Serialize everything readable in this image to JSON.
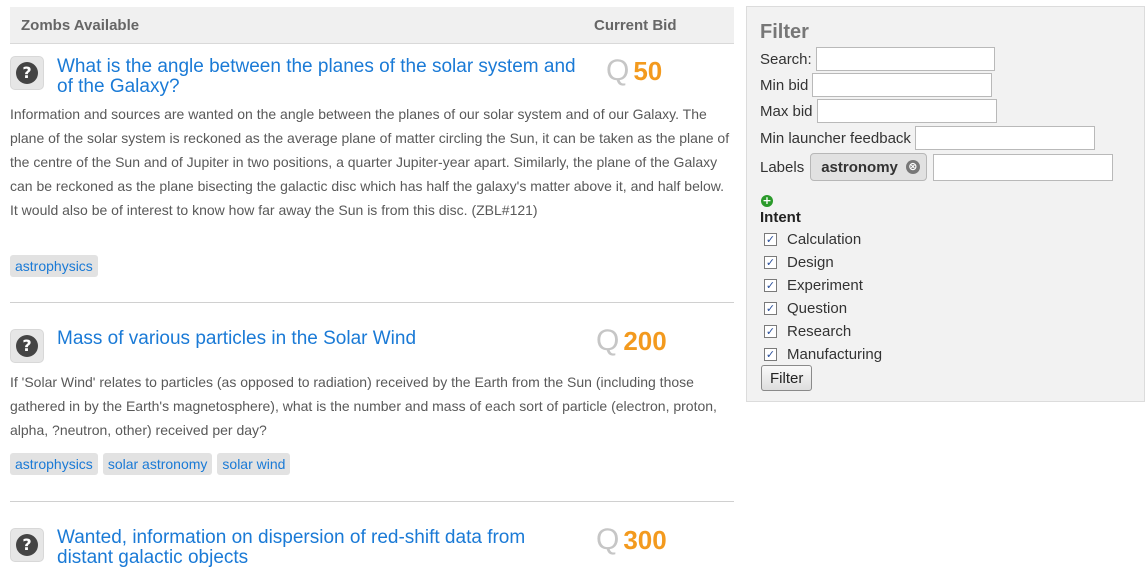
{
  "listing": {
    "col_title": "Zombs Available",
    "col_bid": "Current Bid",
    "bid_symbol": "Q",
    "zombs": [
      {
        "title": "What is the angle between the planes of the solar system and of the Galaxy?",
        "bid": "50",
        "description": "Information and sources are wanted on the angle between the planes of our solar system and of our Galaxy. The plane of the solar system is reckoned as the average plane of matter circling the Sun, it can be taken as the plane of the centre of the Sun and of Jupiter in two positions, a quarter Jupiter-year apart. Similarly, the plane of the Galaxy can be reckoned as the plane bisecting the galactic disc which has half the galaxy's matter above it, and half below. It would also be of interest to know how far away the Sun is from this disc. (ZBL#121)",
        "tags": [
          "astrophysics"
        ]
      },
      {
        "title": "Mass of various particles in the Solar Wind",
        "bid": "200",
        "description": "If 'Solar Wind' relates to particles (as opposed to radiation) received by the Earth from the Sun (including those gathered in by the Earth's magnetosphere), what is the number and mass of each sort of particle (electron, proton, alpha, ?neutron, other) received per day?",
        "tags": [
          "astrophysics",
          "solar astronomy",
          "solar wind"
        ]
      },
      {
        "title": "Wanted, information on dispersion of red-shift data from distant galactic objects",
        "bid": "300",
        "description": "",
        "tags": []
      }
    ]
  },
  "filter": {
    "title": "Filter",
    "search_label": "Search:",
    "search_value": "",
    "min_bid_label": "Min bid",
    "min_bid_value": "",
    "max_bid_label": "Max bid",
    "max_bid_value": "",
    "min_feedback_label": "Min launcher feedback",
    "min_feedback_value": "",
    "labels_label": "Labels",
    "label_chip": "astronomy",
    "chip_remove": "⊗",
    "labels_input_value": "",
    "add_icon_glyph": "+",
    "intent_title": "Intent",
    "check_glyph": "✓",
    "intents": [
      {
        "label": "Calculation",
        "checked": true
      },
      {
        "label": "Design",
        "checked": true
      },
      {
        "label": "Experiment",
        "checked": true
      },
      {
        "label": "Question",
        "checked": true
      },
      {
        "label": "Research",
        "checked": true
      },
      {
        "label": "Manufacturing",
        "checked": true
      }
    ],
    "button_label": "Filter"
  },
  "colors": {
    "link": "#1a7ad6",
    "bid_amount": "#f39a1e",
    "add_icon": "#2a9a2a"
  },
  "icons": {
    "question": "question-mark-icon",
    "remove": "remove-circle-icon",
    "add": "plus-circle-icon"
  }
}
